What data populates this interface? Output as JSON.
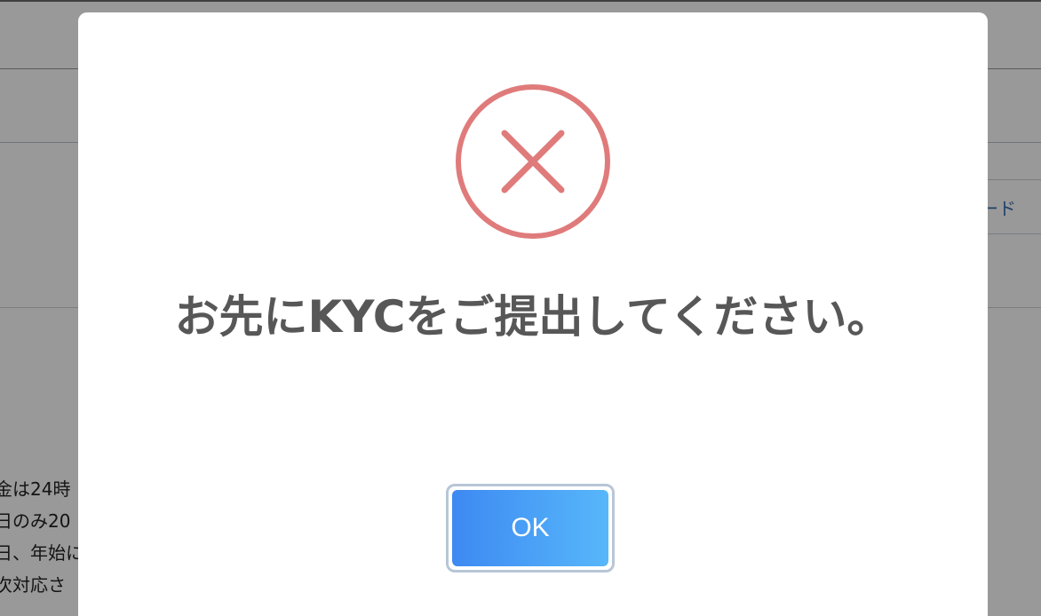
{
  "background": {
    "download_button_fragment": "ード",
    "notes": [
      "金は24時",
      "日のみ20",
      "日、年始に",
      "次対応さ"
    ]
  },
  "dialog": {
    "icon": "error-x-circle-icon",
    "message": "お先にKYCをご提出してください。",
    "ok_label": "OK"
  },
  "colors": {
    "icon": "#e07b7b",
    "message_text": "#575757",
    "button_gradient_start": "#3d89f2",
    "button_gradient_end": "#57b7fa"
  }
}
